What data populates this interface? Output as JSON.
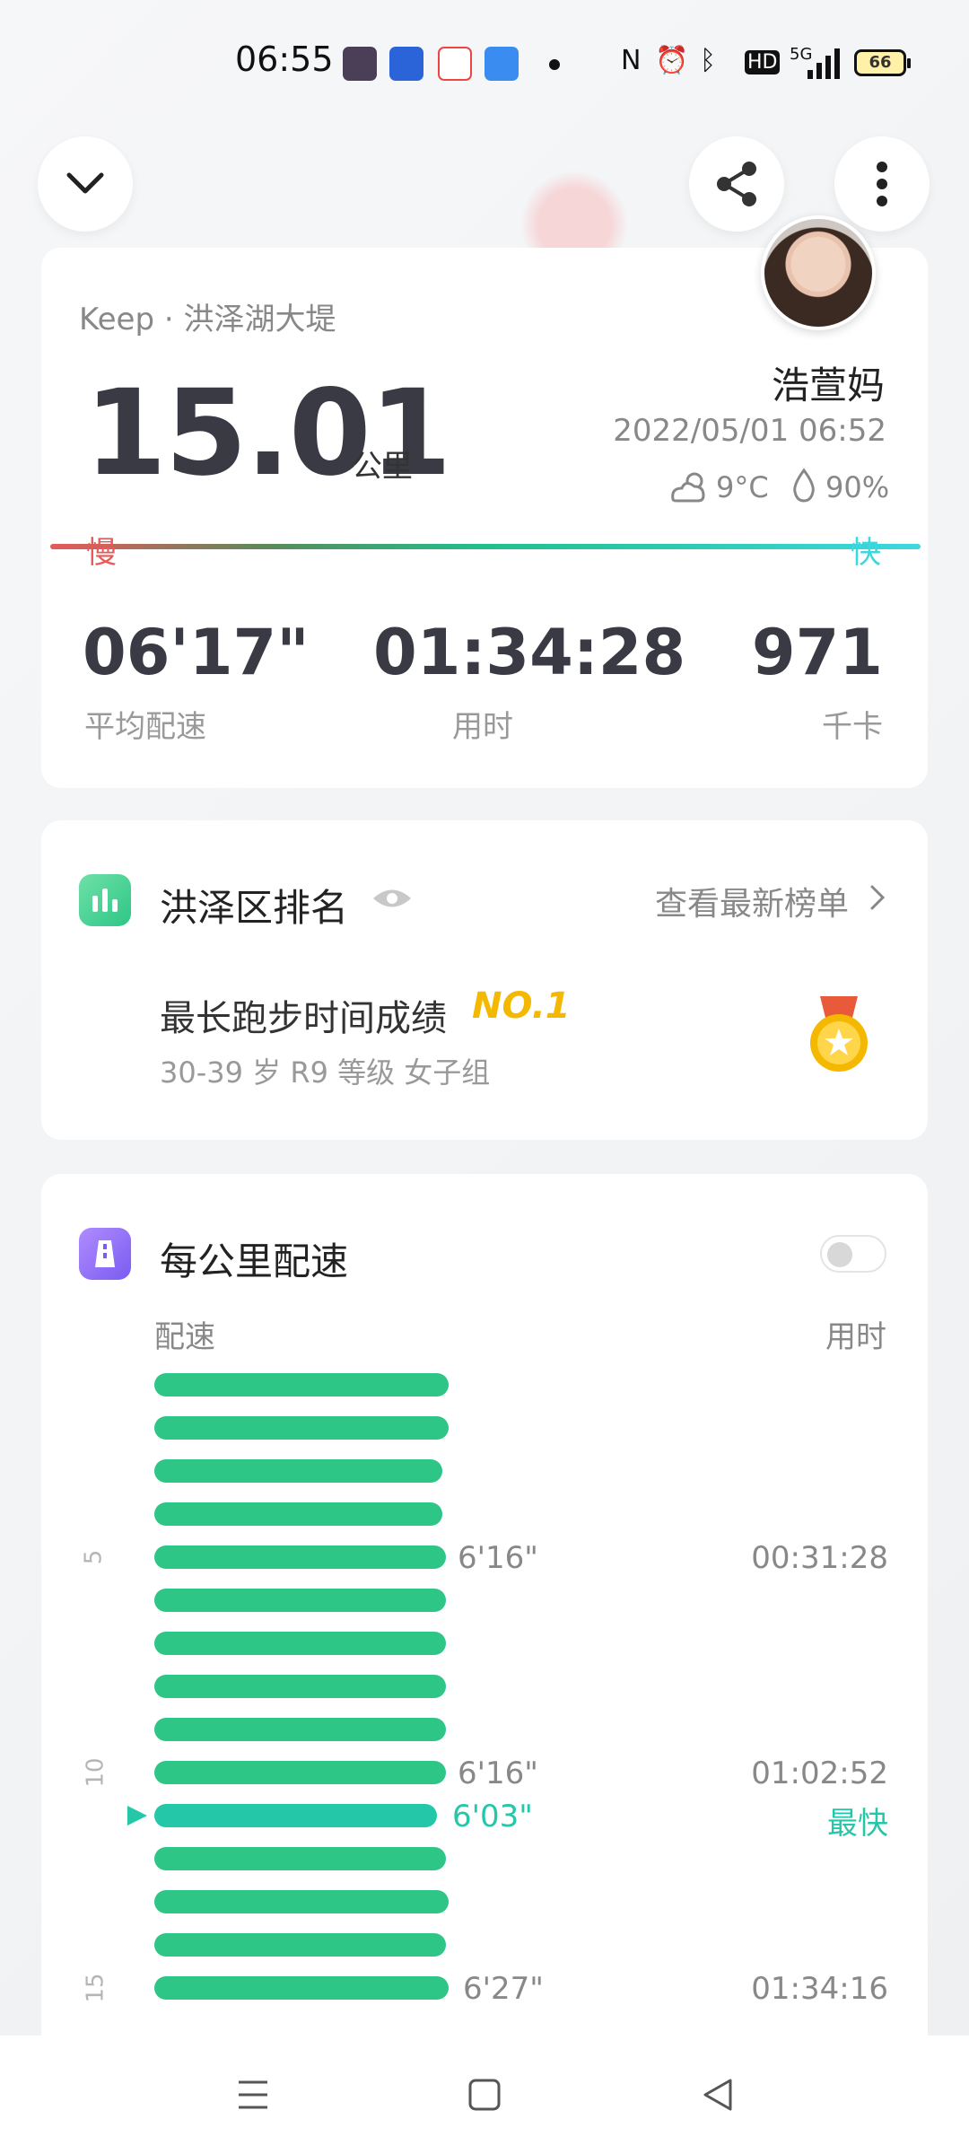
{
  "status_bar": {
    "time": "06:55",
    "signal": "5G",
    "battery": "66"
  },
  "colors": {
    "accent_green": "#2ec686",
    "fast_teal": "#25c7a9",
    "slow_red": "#e65a5a",
    "fast_cyan": "#3cd8e0",
    "gold": "#f5b800"
  },
  "summary": {
    "source": "Keep · 洪泽湖大堤",
    "distance": "15.01",
    "distance_unit": "公里",
    "user_name": "浩萱妈",
    "datetime": "2022/05/01 06:52",
    "temperature": "9°C",
    "humidity": "90%",
    "slow_label": "慢",
    "fast_label": "快",
    "stats": [
      {
        "value": "06'17\"",
        "label": "平均配速"
      },
      {
        "value": "01:34:28",
        "label": "用时"
      },
      {
        "value": "971",
        "label": "千卡"
      }
    ]
  },
  "ranking": {
    "title": "洪泽区排名",
    "link": "查看最新榜单",
    "achievement": "最长跑步时间成绩",
    "rank": "NO.1",
    "group": "30-39 岁 R9 等级 女子组"
  },
  "pace": {
    "title": "每公里配速",
    "col_pace": "配速",
    "col_time": "用时",
    "fastest_label": "最快",
    "bar_fractions": [
      1.0,
      1.0,
      0.98,
      0.98,
      0.99,
      0.99,
      0.99,
      0.99,
      0.99,
      0.99,
      0.96,
      0.99,
      1.0,
      0.99,
      1.0
    ],
    "fastest_index": 10,
    "annotations": [
      {
        "km": "5",
        "pace": "6'16\"",
        "time": "00:31:28",
        "index": 4
      },
      {
        "km": "10",
        "pace": "6'16\"",
        "time": "01:02:52",
        "index": 9
      },
      {
        "km": "15",
        "pace": "6'27\"",
        "time": "01:34:16",
        "index": 14
      }
    ],
    "fastest_pace": "6'03\""
  }
}
